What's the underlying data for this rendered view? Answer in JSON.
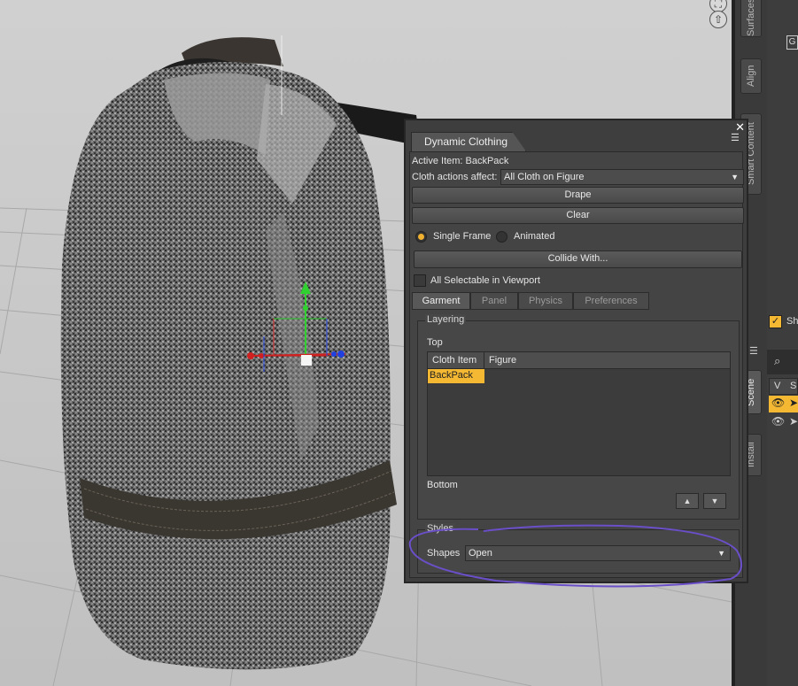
{
  "viewport": {
    "tools": {
      "transform_icon": "square-arrows-icon",
      "orbit_icon": "orbit-arrow-icon"
    }
  },
  "side_tabs": [
    {
      "label": "Surfaces",
      "active": false
    },
    {
      "label": "Align",
      "active": false
    },
    {
      "label": "Smart Content",
      "active": false
    },
    {
      "label": "Scene",
      "active": true
    },
    {
      "label": "Install",
      "active": false
    }
  ],
  "dynamic_clothing": {
    "title": "Dynamic Clothing",
    "active_item_label": "Active Item: BackPack",
    "cloth_actions_label": "Cloth actions affect:",
    "cloth_actions_value": "All Cloth on Figure",
    "drape_label": "Drape",
    "clear_label": "Clear",
    "single_frame_label": "Single Frame",
    "animated_label": "Animated",
    "collide_label": "Collide With...",
    "all_selectable_label": "All Selectable in Viewport",
    "tabs": [
      "Garment",
      "Panel",
      "Physics",
      "Preferences"
    ],
    "layering": {
      "title": "Layering",
      "top_label": "Top",
      "bottom_label": "Bottom",
      "columns": [
        "Cloth Item",
        "Figure"
      ],
      "rows": [
        {
          "item": "BackPack",
          "figure": ""
        }
      ]
    },
    "styles": {
      "title": "Styles",
      "shapes_label": "Shapes",
      "shapes_value": "Open"
    }
  },
  "right_panel": {
    "top_button_text": "G",
    "checkbox_label": "Sh",
    "col_v": "V",
    "col_s": "S"
  },
  "colors": {
    "accent": "#f4b832",
    "annotation": "#6a4fc8"
  }
}
